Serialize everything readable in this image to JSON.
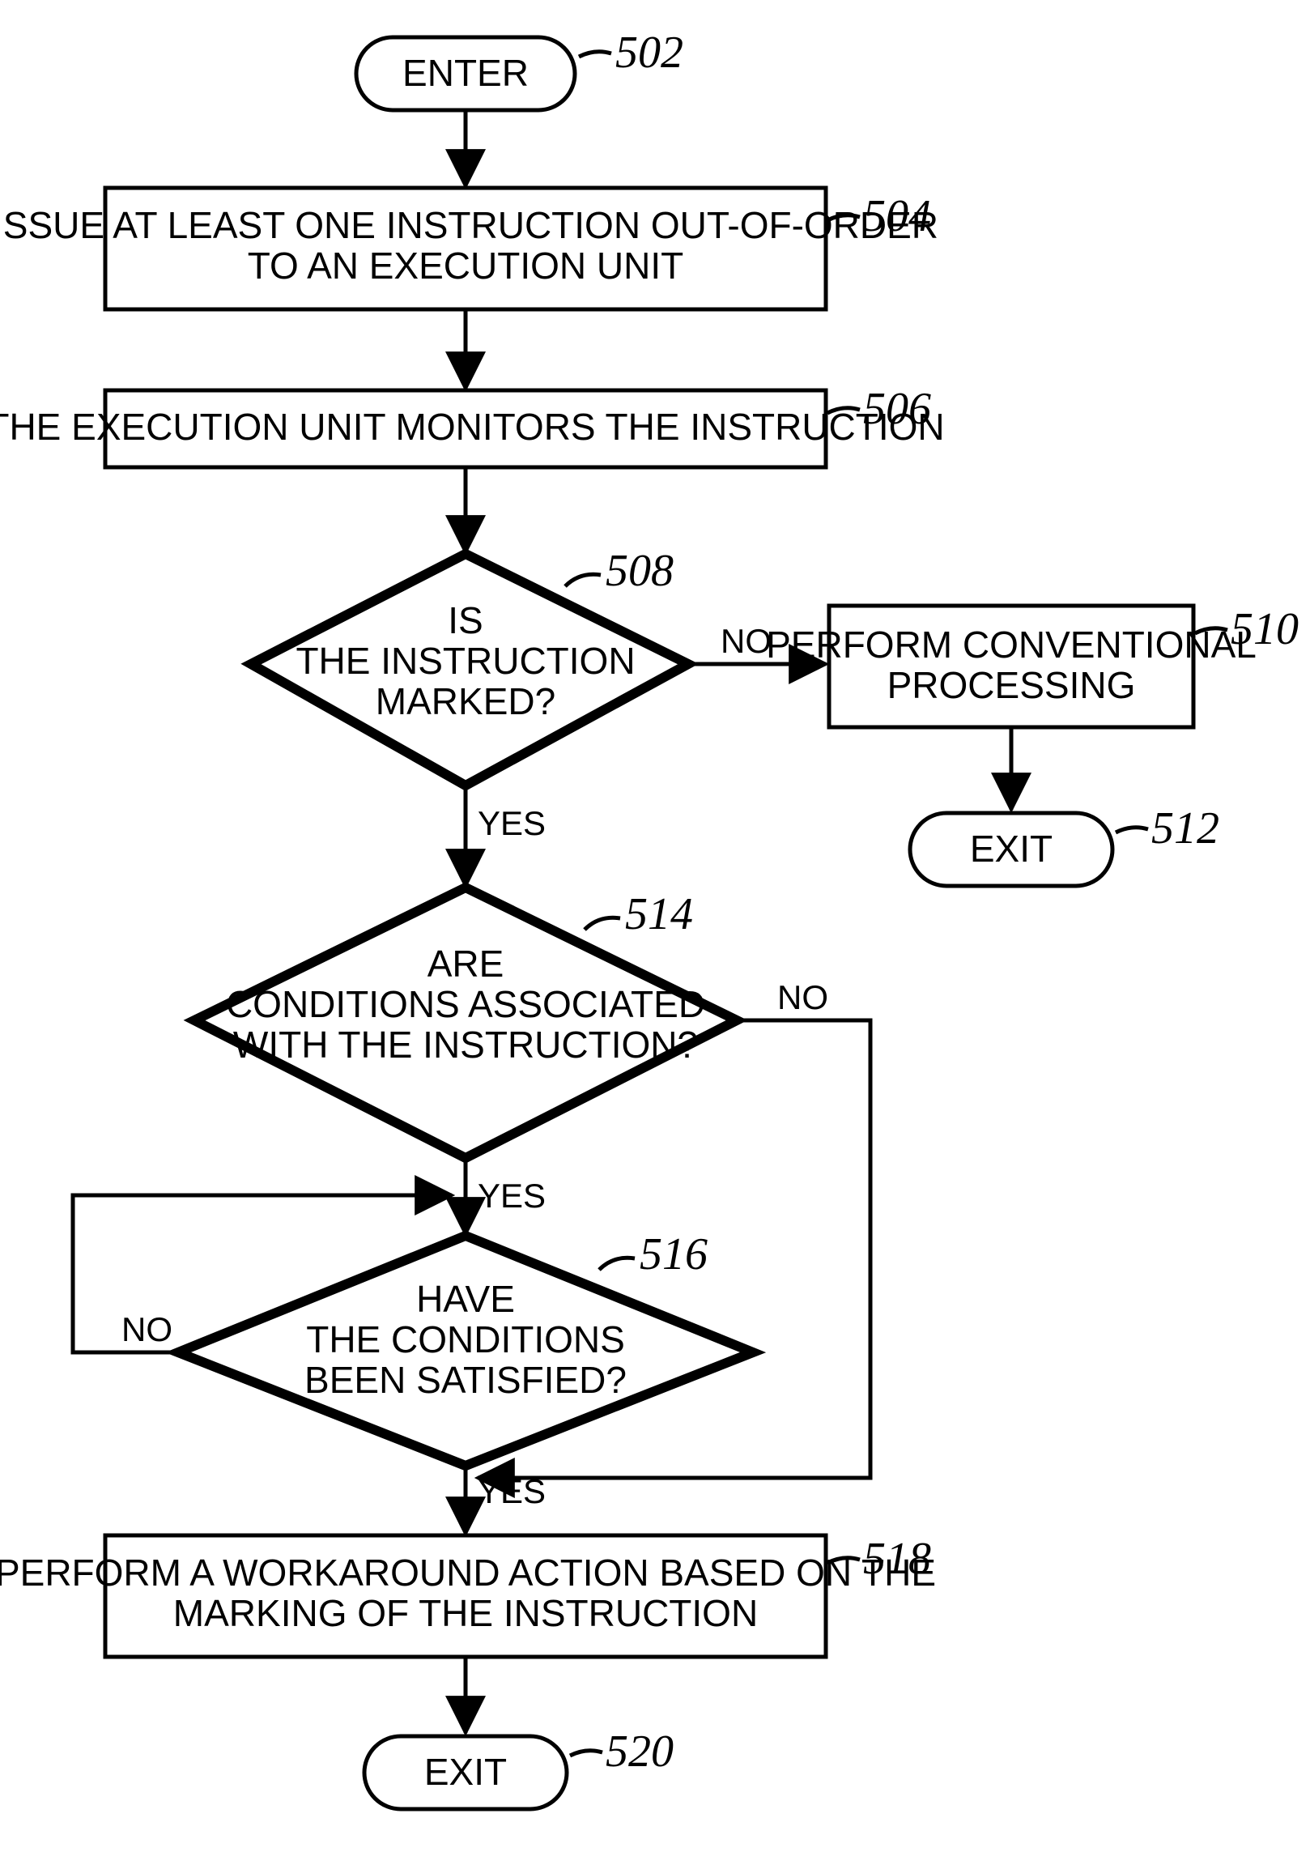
{
  "nodes": {
    "enter": {
      "label": "ENTER",
      "ref": "502"
    },
    "issue": {
      "line1": "ISSUE AT LEAST ONE INSTRUCTION OUT-OF-ORDER",
      "line2": "TO AN EXECUTION UNIT",
      "ref": "504"
    },
    "monitor": {
      "line1": "THE EXECUTION UNIT MONITORS THE INSTRUCTION",
      "ref": "506"
    },
    "marked": {
      "line1": "IS",
      "line2": "THE INSTRUCTION",
      "line3": "MARKED?",
      "ref": "508"
    },
    "perform": {
      "line1": "PERFORM CONVENTIONAL",
      "line2": "PROCESSING",
      "ref": "510"
    },
    "exit1": {
      "label": "EXIT",
      "ref": "512"
    },
    "assoc": {
      "line1": "ARE",
      "line2": "CONDITIONS ASSOCIATED",
      "line3": "WITH THE INSTRUCTION?",
      "ref": "514"
    },
    "satis": {
      "line1": "HAVE",
      "line2": "THE CONDITIONS",
      "line3": "BEEN SATISFIED?",
      "ref": "516"
    },
    "work": {
      "line1": "PERFORM A WORKAROUND ACTION BASED ON THE",
      "line2": "MARKING OF THE INSTRUCTION",
      "ref": "518"
    },
    "exit2": {
      "label": "EXIT",
      "ref": "520"
    }
  },
  "edges": {
    "yes": "YES",
    "no": "NO"
  }
}
